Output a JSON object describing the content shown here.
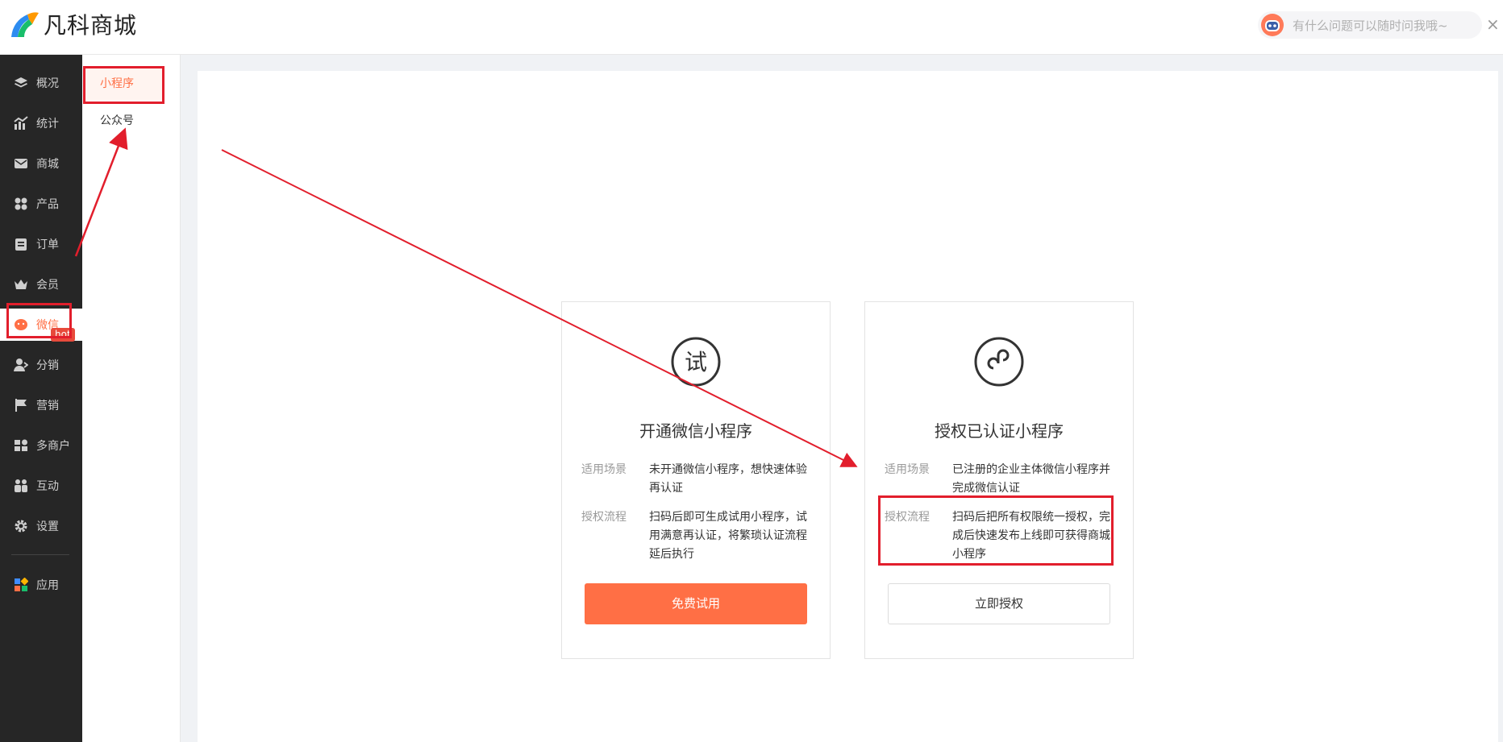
{
  "header": {
    "logo_text": "凡科商城",
    "assistant_placeholder": "有什么问题可以随时问我哦~",
    "close_symbol": "×"
  },
  "nav": {
    "items": [
      {
        "label": "概况",
        "icon": "layers-icon"
      },
      {
        "label": "统计",
        "icon": "chart-icon"
      },
      {
        "label": "商城",
        "icon": "mail-icon"
      },
      {
        "label": "产品",
        "icon": "grid-icon"
      },
      {
        "label": "订单",
        "icon": "clipboard-icon"
      },
      {
        "label": "会员",
        "icon": "crown-icon"
      },
      {
        "label": "微信",
        "icon": "wechat-icon"
      },
      {
        "label": "分销",
        "icon": "user-share-icon"
      },
      {
        "label": "营销",
        "icon": "flag-icon"
      },
      {
        "label": "多商户",
        "icon": "shop-icon"
      },
      {
        "label": "互动",
        "icon": "people-icon"
      },
      {
        "label": "设置",
        "icon": "gear-icon"
      },
      {
        "label": "应用",
        "icon": "apps-icon"
      }
    ],
    "active_item": "微信",
    "hot_badge": "hot"
  },
  "submenu": {
    "items": [
      "小程序",
      "公众号"
    ],
    "active_item": "小程序"
  },
  "cards": [
    {
      "badge_text": "试",
      "badge_icon": "trial-icon",
      "title": "开通微信小程序",
      "scene_label": "适用场景",
      "scene_value": "未开通微信小程序，想快速体验再认证",
      "flow_label": "授权流程",
      "flow_value": "扫码后即可生成试用小程序，试用满意再认证，将繁琐认证流程延后执行",
      "button": "免费试用"
    },
    {
      "badge_icon": "mini-program-icon",
      "title": "授权已认证小程序",
      "scene_label": "适用场景",
      "scene_value": "已注册的企业主体微信小程序并完成微信认证",
      "flow_label": "授权流程",
      "flow_value": "扫码后把所有权限统一授权，完成后快速发布上线即可获得商城小程序",
      "button": "立即授权"
    }
  ],
  "colors": {
    "accent": "#ff6f45",
    "nav_bg": "#262626",
    "annotation_red": "#e21e2c",
    "hot_badge": "#e84a3b"
  }
}
